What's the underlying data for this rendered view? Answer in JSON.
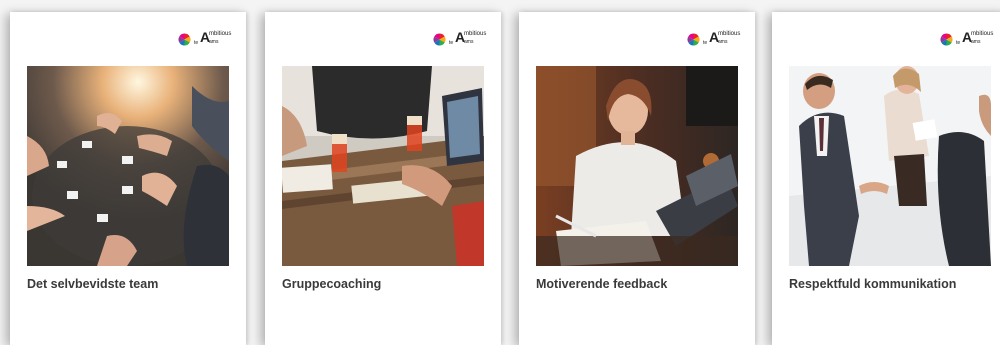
{
  "brand": {
    "logo_main": "A",
    "logo_line1": "mbitious",
    "logo_line2": "te",
    "logo_line3": "ams",
    "colors": [
      "#e8242a",
      "#f7a81b",
      "#2bb04a",
      "#1c75bc",
      "#8e3a97",
      "#ec008c"
    ]
  },
  "covers": [
    {
      "title": "Det selvbevidste team"
    },
    {
      "title": "Gruppecoaching"
    },
    {
      "title": "Motiverende feedback"
    },
    {
      "title": "Respektfuld kommunikation"
    }
  ]
}
